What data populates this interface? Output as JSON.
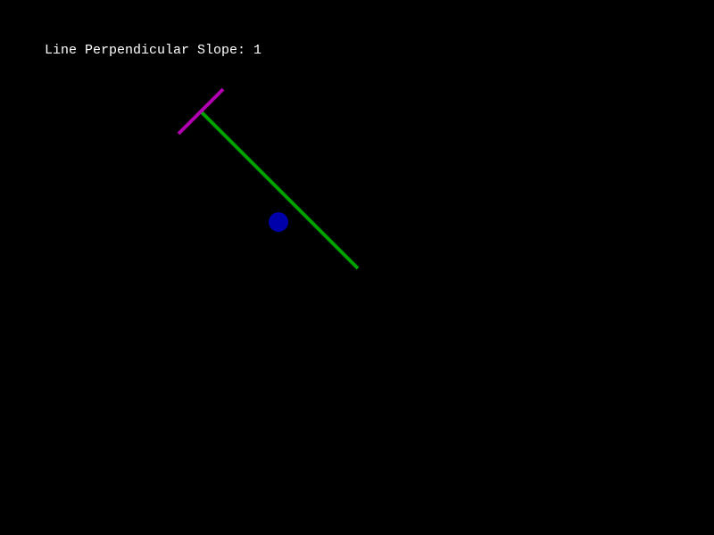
{
  "hud": {
    "slope_label": "Line Perpendicular Slope: 1"
  },
  "colors": {
    "background": "#000000",
    "text": "#ffffff",
    "main_line": "#00a000",
    "perpendicular_line": "#b000b0",
    "ball": "#0000aa"
  },
  "scene": {
    "perpendicular_slope": 1
  }
}
